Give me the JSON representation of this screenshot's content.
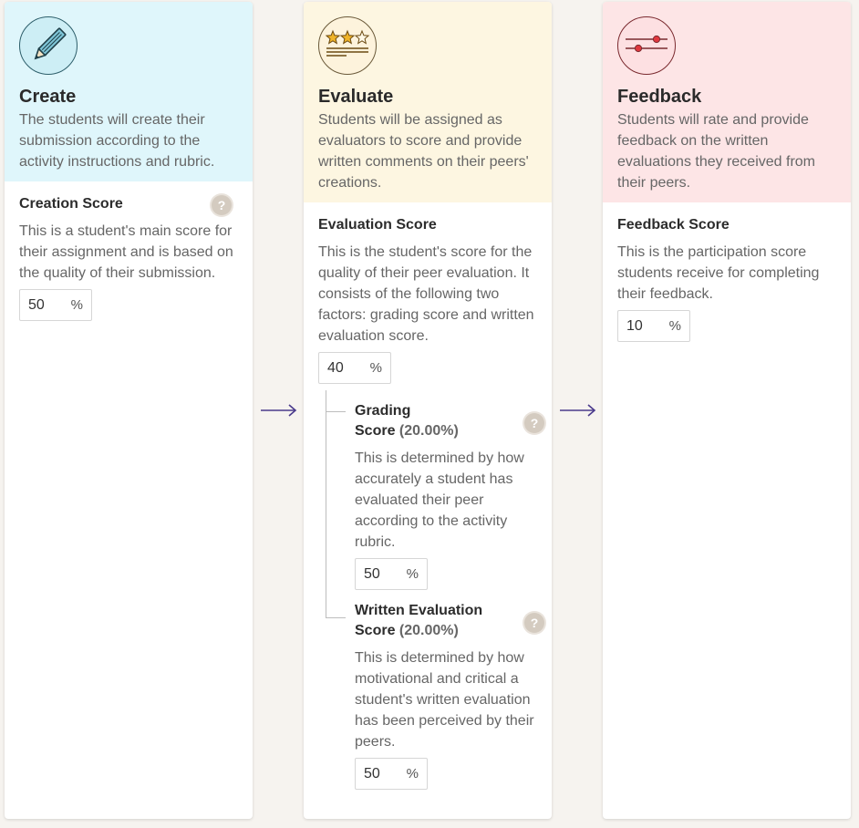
{
  "create": {
    "title": "Create",
    "description": "The students will create their submission according to the activity instructions and rubric.",
    "score_title": "Creation Score",
    "score_desc": "This is a student's main score for their assignment and is based on the quality of their submission.",
    "value": "50",
    "unit": "%",
    "icon": "pencil-icon",
    "color": "#dff6fb"
  },
  "evaluate": {
    "title": "Evaluate",
    "description": "Students will be assigned as evaluators to score and provide written comments on their peers' creations.",
    "score_title": "Evaluation Score",
    "score_desc": "This is the student's score for the quality of their peer evaluation. It consists of the following two factors: grading score and written evaluation score.",
    "value": "40",
    "unit": "%",
    "icon": "stars-rating-icon",
    "color": "#fdf6e1",
    "grading": {
      "title_1": "Grading",
      "title_2": "Score",
      "pct": "(20.00%)",
      "desc": "This is determined by how accurately a student has evaluated their peer according to the activity rubric.",
      "value": "50",
      "unit": "%"
    },
    "written": {
      "title_1": "Written Evaluation",
      "title_2": "Score",
      "pct": "(20.00%)",
      "desc": "This is determined by how motivational and critical a student's written evaluation has been perceived by their peers.",
      "value": "50",
      "unit": "%"
    }
  },
  "feedback": {
    "title": "Feedback",
    "description": "Students will rate and provide feedback on the written evaluations they received from their peers.",
    "score_title": "Feedback Score",
    "score_desc": "This is the participation score students receive for completing their feedback.",
    "value": "10",
    "unit": "%",
    "icon": "sliders-icon",
    "color": "#fde5e6"
  },
  "help_glyph": "?",
  "arrow_color": "#4a3a8c"
}
